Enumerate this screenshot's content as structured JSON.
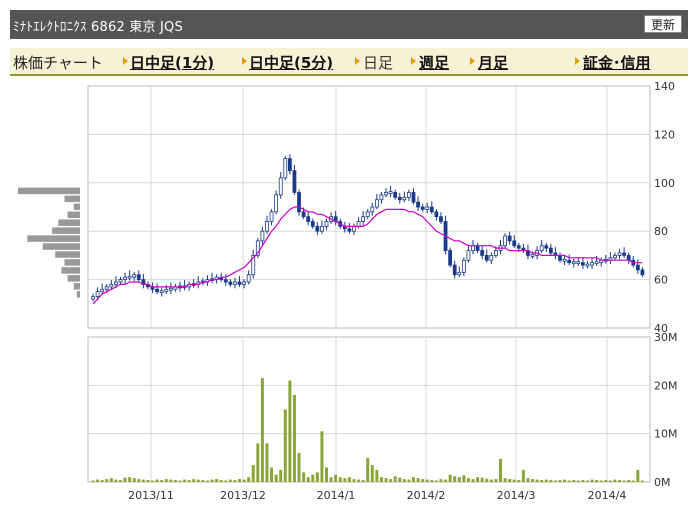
{
  "header": {
    "title": "ﾐﾅﾄｴﾚｸﾄﾛﾆｸｽ  6862  東京 JQS",
    "refresh_label": "更新"
  },
  "nav": {
    "chart_label": "株価チャート",
    "items": [
      {
        "label": "日中足(1分)",
        "link": true
      },
      {
        "label": "日中足(5分)",
        "link": true
      },
      {
        "label": "日足",
        "link": false
      },
      {
        "label": "週足",
        "link": true
      },
      {
        "label": "月足",
        "link": true
      },
      {
        "label": "証金･信用",
        "link": true
      }
    ],
    "arrow_color": "#e0a000"
  },
  "colors": {
    "candle": "#1a3a8a",
    "moving_average": "#cc00cc",
    "volume": "#8aa63a",
    "grid": "#d8d8d8",
    "volume_profile": "#999999"
  },
  "chart_data": [
    {
      "type": "candlestick",
      "y_ticks": [
        40,
        60,
        80,
        100,
        120,
        140
      ],
      "ylim": [
        40,
        140
      ],
      "x_tick_labels": [
        "2013/11",
        "2013/12",
        "2014/1",
        "2014/2",
        "2014/3",
        "2014/4"
      ],
      "series_close": [
        53,
        55,
        56,
        57,
        58,
        59,
        60,
        61,
        61,
        62,
        60,
        58,
        57,
        56,
        55,
        55,
        56,
        56,
        57,
        57,
        57,
        58,
        58,
        59,
        59,
        60,
        60,
        61,
        60,
        59,
        58,
        59,
        58,
        59,
        62,
        70,
        76,
        80,
        84,
        88,
        95,
        102,
        110,
        105,
        96,
        88,
        86,
        84,
        82,
        80,
        82,
        84,
        86,
        84,
        82,
        81,
        80,
        82,
        84,
        86,
        88,
        90,
        93,
        95,
        96,
        96,
        94,
        93,
        94,
        96,
        92,
        90,
        89,
        90,
        88,
        86,
        84,
        72,
        66,
        62,
        63,
        68,
        72,
        74,
        72,
        70,
        68,
        70,
        72,
        74,
        78,
        76,
        74,
        73,
        72,
        70,
        70,
        72,
        74,
        73,
        71,
        70,
        68,
        68,
        67,
        67,
        67,
        66,
        66,
        67,
        67,
        68,
        68,
        69,
        70,
        71,
        70,
        68,
        66,
        64,
        62
      ],
      "moving_average": [
        50,
        52,
        54,
        55,
        56,
        57,
        58,
        58,
        59,
        59,
        59,
        58,
        58,
        57,
        57,
        57,
        57,
        57,
        57,
        57,
        57,
        58,
        58,
        58,
        59,
        59,
        60,
        60,
        61,
        61,
        62,
        63,
        64,
        65,
        67,
        69,
        71,
        74,
        77,
        80,
        82,
        85,
        87,
        89,
        90,
        90,
        89,
        88,
        88,
        87,
        87,
        86,
        85,
        84,
        83,
        82,
        82,
        82,
        82,
        82,
        83,
        85,
        87,
        88,
        89,
        89,
        89,
        89,
        89,
        88,
        88,
        87,
        86,
        84,
        82,
        80,
        79,
        78,
        77,
        76,
        76,
        75,
        74,
        74,
        74,
        74,
        74,
        74,
        73,
        73,
        73,
        72,
        72,
        72,
        72,
        72,
        71,
        71,
        70,
        70,
        70,
        70,
        70,
        70,
        69,
        69,
        69,
        69,
        69,
        69,
        69,
        68,
        68,
        68,
        68,
        68,
        68,
        68,
        67,
        67,
        67
      ]
    },
    {
      "type": "bar",
      "y_ticks": [
        "0M",
        "10M",
        "20M",
        "30M"
      ],
      "ylim": [
        0,
        30
      ],
      "x_tick_labels": [
        "2013/11",
        "2013/12",
        "2014/1",
        "2014/2",
        "2014/3",
        "2014/4"
      ],
      "values": [
        0.3,
        0.5,
        0.4,
        0.6,
        0.8,
        0.5,
        0.4,
        0.9,
        1.0,
        0.8,
        0.6,
        0.5,
        0.4,
        0.3,
        0.5,
        0.4,
        0.6,
        0.5,
        0.4,
        0.3,
        0.5,
        0.4,
        0.6,
        0.5,
        0.4,
        0.3,
        0.5,
        0.6,
        0.4,
        0.3,
        0.5,
        0.4,
        0.6,
        0.5,
        1.0,
        3.5,
        8.0,
        21.5,
        8.0,
        3.0,
        1.5,
        2.5,
        15.0,
        21.0,
        18.0,
        6.0,
        2.0,
        1.0,
        1.5,
        2.0,
        10.5,
        3.0,
        1.0,
        1.5,
        1.0,
        0.8,
        1.0,
        0.6,
        0.5,
        0.4,
        5.0,
        3.5,
        2.5,
        1.0,
        0.8,
        0.6,
        1.2,
        0.9,
        0.6,
        0.5,
        1.0,
        0.8,
        0.6,
        0.5,
        0.4,
        0.3,
        0.6,
        0.5,
        1.5,
        1.2,
        1.0,
        1.4,
        0.8,
        0.6,
        1.0,
        0.9,
        0.7,
        0.5,
        0.6,
        4.8,
        0.8,
        0.6,
        0.5,
        0.4,
        2.5,
        0.8,
        0.6,
        0.5,
        0.4,
        0.5,
        0.4,
        0.3,
        0.4,
        0.5,
        0.3,
        0.4,
        0.3,
        0.4,
        0.3,
        0.5,
        0.4,
        0.3,
        0.4,
        0.3,
        0.5,
        0.4,
        0.3,
        0.4,
        0.3,
        2.5,
        0.3
      ]
    }
  ],
  "volume_profile": [
    1.0,
    0.25,
    0.1,
    0.2,
    0.35,
    0.45,
    0.85,
    0.6,
    0.4,
    0.25,
    0.3,
    0.2,
    0.1,
    0.05
  ]
}
